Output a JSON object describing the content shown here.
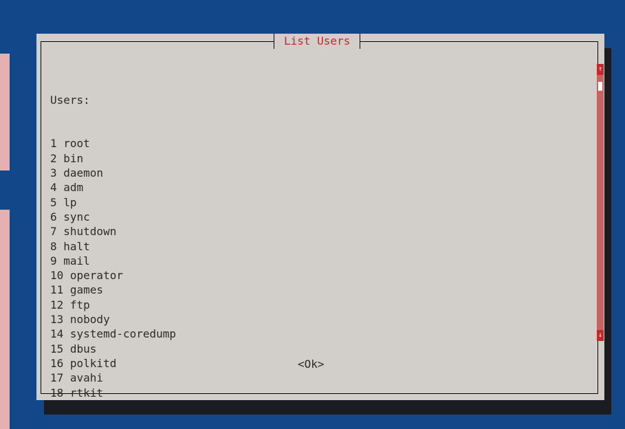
{
  "dialog": {
    "title": "List Users",
    "heading": "Users:",
    "ok_label": "<Ok>"
  },
  "users": [
    "1 root",
    "2 bin",
    "3 daemon",
    "4 adm",
    "5 lp",
    "6 sync",
    "7 shutdown",
    "8 halt",
    "9 mail",
    "10 operator",
    "11 games",
    "12 ftp",
    "13 nobody",
    "14 systemd-coredump",
    "15 dbus",
    "16 polkitd",
    "17 avahi",
    "18 rtkit"
  ],
  "scrollbar": {
    "up_icon": "↑",
    "down_icon": "↓",
    "position": 0.05
  },
  "colors": {
    "background": "#12478a",
    "dialog": "#d2cfcb",
    "title": "#c3282b",
    "scrollbar_track": "#c96262",
    "scrollbar_arrow": "#c3282b"
  }
}
